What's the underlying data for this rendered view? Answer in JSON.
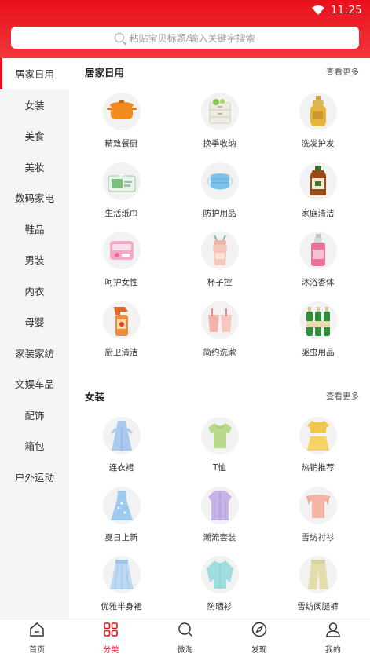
{
  "status": {
    "time": "11:25"
  },
  "search": {
    "placeholder": "粘贴宝贝标题/输入关键字搜索"
  },
  "sidebar": {
    "items": [
      {
        "label": "居家日用",
        "active": true
      },
      {
        "label": "女装"
      },
      {
        "label": "美食"
      },
      {
        "label": "美妆"
      },
      {
        "label": "数码家电"
      },
      {
        "label": "鞋品"
      },
      {
        "label": "男装"
      },
      {
        "label": "内衣"
      },
      {
        "label": "母婴"
      },
      {
        "label": "家装家纺"
      },
      {
        "label": "文娱车品"
      },
      {
        "label": "配饰"
      },
      {
        "label": "箱包"
      },
      {
        "label": "户外运动"
      }
    ]
  },
  "sections": [
    {
      "title": "居家日用",
      "more": "查看更多",
      "items": [
        {
          "label": "精致餐厨",
          "icon": "cooking-pot-icon"
        },
        {
          "label": "换季收纳",
          "icon": "storage-box-icon"
        },
        {
          "label": "洗发护发",
          "icon": "shampoo-bottle-icon"
        },
        {
          "label": "生活纸巾",
          "icon": "tissue-pack-icon"
        },
        {
          "label": "防护用品",
          "icon": "face-mask-icon"
        },
        {
          "label": "家庭清洁",
          "icon": "disinfectant-bottle-icon"
        },
        {
          "label": "呵护女性",
          "icon": "sanitary-pad-icon"
        },
        {
          "label": "杯子控",
          "icon": "cup-icon"
        },
        {
          "label": "沐浴香体",
          "icon": "body-mist-icon"
        },
        {
          "label": "厨卫清洁",
          "icon": "spray-bottle-icon"
        },
        {
          "label": "简约洗漱",
          "icon": "toothbrush-cup-icon"
        },
        {
          "label": "驱虫用品",
          "icon": "insecticide-bottles-icon"
        }
      ]
    },
    {
      "title": "女装",
      "more": "查看更多",
      "items": [
        {
          "label": "连衣裙",
          "icon": "dress-icon"
        },
        {
          "label": "T恤",
          "icon": "tshirt-icon"
        },
        {
          "label": "热销推荐",
          "icon": "crop-top-set-icon"
        },
        {
          "label": "夏日上新",
          "icon": "summer-dress-icon"
        },
        {
          "label": "潮流套装",
          "icon": "shirt-set-icon"
        },
        {
          "label": "雪纺衬衫",
          "icon": "chiffon-blouse-icon"
        },
        {
          "label": "优雅半身裙",
          "icon": "skirt-icon"
        },
        {
          "label": "防晒衫",
          "icon": "sun-jacket-icon"
        },
        {
          "label": "雪纺阔腿裤",
          "icon": "wide-pants-icon"
        }
      ]
    }
  ],
  "tabbar": [
    {
      "label": "首页",
      "icon": "home-icon"
    },
    {
      "label": "分类",
      "icon": "category-grid-icon",
      "active": true
    },
    {
      "label": "微淘",
      "icon": "search-circle-icon"
    },
    {
      "label": "发现",
      "icon": "compass-icon"
    },
    {
      "label": "我的",
      "icon": "profile-icon"
    }
  ],
  "colors": {
    "accent": "#e8111c",
    "sidebar_bg": "#f5f5f5",
    "text": "#333333"
  }
}
